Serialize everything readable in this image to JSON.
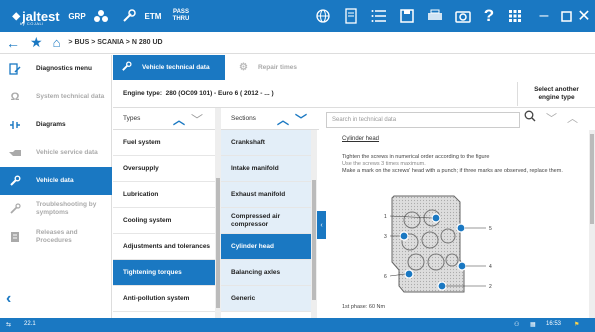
{
  "topbar": {
    "logo": "jaltest",
    "logo_sub": "by COJALI",
    "grp": "GRP",
    "etm": "ETM",
    "pass_line1": "PASS",
    "pass_line2": "THRU",
    "help": "?"
  },
  "breadcrumb": {
    "bus": "BUS",
    "make": "SCANIA",
    "model": "N 280 UD",
    "sep": ">"
  },
  "sidebar": {
    "items": [
      {
        "label": "Diagnostics menu",
        "icon": "diagnostics-icon"
      },
      {
        "label": "System technical data",
        "icon": "omega-icon"
      },
      {
        "label": "Diagrams",
        "icon": "diagram-icon"
      },
      {
        "label": "Vehicle service data",
        "icon": "oil-can-icon"
      },
      {
        "label": "Vehicle data",
        "icon": "wrench-icon"
      },
      {
        "label": "Troubleshooting by symptoms",
        "icon": "troubleshoot-icon"
      },
      {
        "label": "Releases and Procedures",
        "icon": "document-icon"
      }
    ]
  },
  "tabs": {
    "vehicle_technical_data": "Vehicle technical data",
    "repair_times": "Repair times"
  },
  "engine": {
    "label": "Engine type:",
    "value": "280 (OC09 101) - Euro 6 ( 2012 - ... )",
    "select_line1": "Select another",
    "select_line2": "engine type"
  },
  "types": {
    "header": "Types",
    "items": [
      "Fuel system",
      "Oversupply",
      "Lubrication",
      "Cooling system",
      "Adjustments and tolerances",
      "Tightening torques",
      "Anti-pollution system"
    ],
    "selected_index": 5
  },
  "sections": {
    "header": "Sections",
    "items": [
      "Crankshaft",
      "Intake manifold",
      "Exhaust manifold",
      "Compressed air compressor",
      "Cylinder head",
      "Balancing axles",
      "Generic"
    ],
    "selected_index": 4
  },
  "search": {
    "placeholder": "Search in technical data"
  },
  "content": {
    "title": "Cylinder head",
    "line1": "Tighten the screws in numerical order according to the figure",
    "line2": "Use the screws 3 times maximum.",
    "line3": "Make a mark on the screws' head with a punch; if three marks are observed, replace them.",
    "phase": "1st phase: 60 Nm",
    "callouts": [
      "1",
      "2",
      "3",
      "4",
      "5",
      "6"
    ]
  },
  "statusbar": {
    "voltage": "22.1",
    "time": "16:53"
  },
  "colors": {
    "accent": "#1a78c2",
    "section_bg": "#e3eef8"
  }
}
